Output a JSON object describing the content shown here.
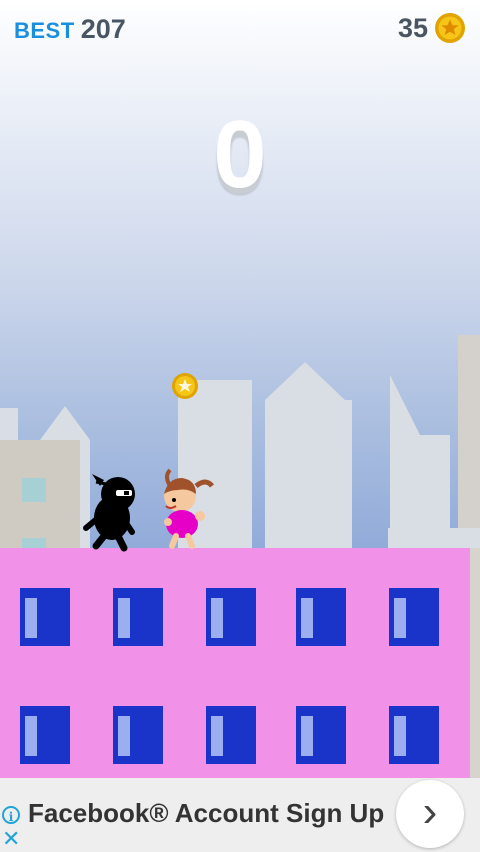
{
  "hud": {
    "best_label": "BEST",
    "best_value": "207",
    "coins": "35",
    "coin_icon": "star-coin-icon"
  },
  "score": "0",
  "colors": {
    "building": "#f291e8",
    "window_frame": "#1a33c8",
    "window_glass": "#9aaef0",
    "coin": "#f5c518",
    "best_label": "#1a8fe0"
  },
  "ad": {
    "text": "Facebook® Account Sign Up",
    "info_icon": "info-icon",
    "close_icon": "close-icon",
    "arrow_icon": "chevron-right-icon"
  }
}
